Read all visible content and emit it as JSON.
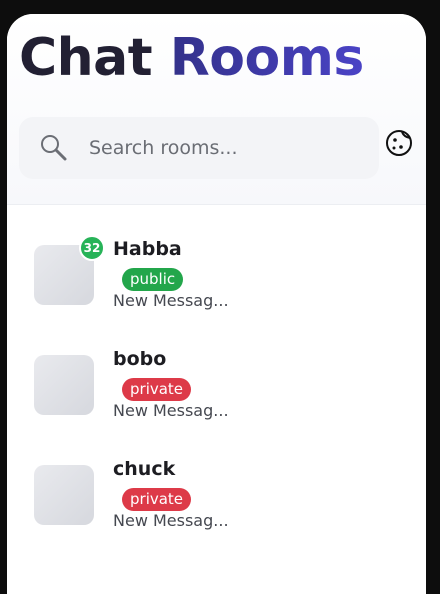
{
  "header": {
    "title_part1": "Chat",
    "title_part2": "Rooms"
  },
  "search": {
    "placeholder": "Search rooms...",
    "value": "",
    "icon": "search-icon"
  },
  "theme_toggle": {
    "icon": "cookie-icon"
  },
  "rooms": [
    {
      "name": "Habba",
      "visibility": "public",
      "preview": "New Messag...",
      "unread": "32"
    },
    {
      "name": "bobo",
      "visibility": "private",
      "preview": "New Messag...",
      "unread": null
    },
    {
      "name": "chuck",
      "visibility": "private",
      "preview": "New Messag...",
      "unread": null
    }
  ],
  "colors": {
    "public": "#23a64b",
    "private": "#dd3a48",
    "badge": "#27b358",
    "title_dark": "#222033",
    "title_accent": "#3f3bb0"
  }
}
